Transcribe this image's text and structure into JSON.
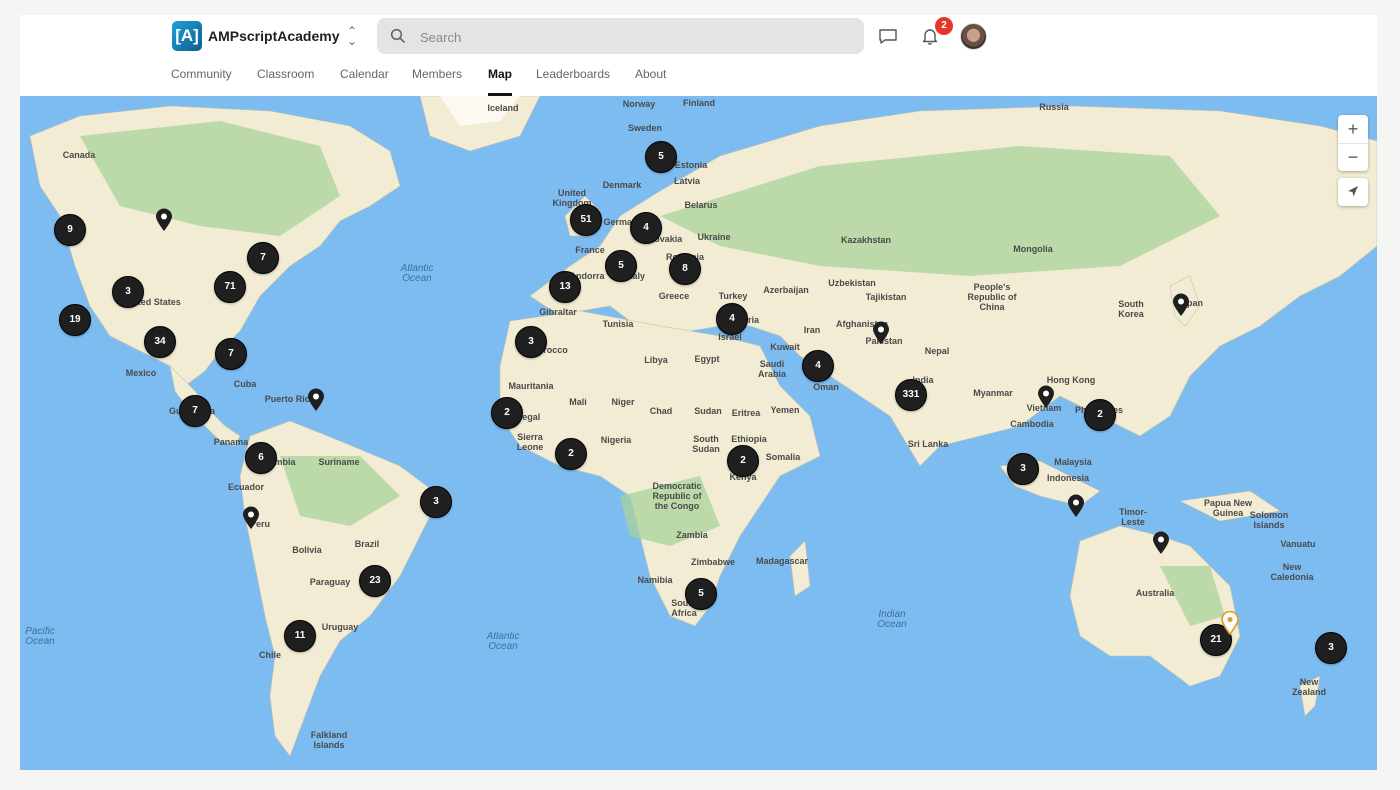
{
  "app": {
    "name": "AMPscriptAcademy",
    "logo_text": "[A]"
  },
  "search": {
    "placeholder": "Search"
  },
  "notifications": {
    "count": "2"
  },
  "nav": [
    {
      "label": "Community",
      "active": false
    },
    {
      "label": "Classroom",
      "active": false
    },
    {
      "label": "Calendar",
      "active": false
    },
    {
      "label": "Members",
      "active": false
    },
    {
      "label": "Map",
      "active": true
    },
    {
      "label": "Leaderboards",
      "active": false
    },
    {
      "label": "About",
      "active": false
    }
  ],
  "map": {
    "colors": {
      "water": "#7dbcf1",
      "land": "#f2ecd4",
      "forest": "#a9d39c",
      "cluster": "#1f1f1f",
      "highlight_pin": "#f2b54a"
    },
    "clusters": [
      "9",
      "7",
      "3",
      "71",
      "19",
      "34",
      "7",
      "7",
      "6",
      "3",
      "23",
      "11",
      "5",
      "51",
      "4",
      "5",
      "8",
      "13",
      "3",
      "2",
      "2",
      "4",
      "4",
      "2",
      "5",
      "331",
      "2",
      "3",
      "21",
      "3"
    ],
    "labels": {
      "countries": [
        "Canada",
        "United States",
        "Mexico",
        "Cuba",
        "Puerto Rico",
        "Guatemala",
        "Panama",
        "Colombia",
        "Suriname",
        "Ecuador",
        "Peru",
        "Brazil",
        "Bolivia",
        "Paraguay",
        "Uruguay",
        "Chile",
        "Falkland Islands",
        "Iceland",
        "Norway",
        "Sweden",
        "Finland",
        "Russia",
        "Estonia",
        "Latvia",
        "United Kingdom",
        "Denmark",
        "Belarus",
        "Germany",
        "France",
        "Slovakia",
        "Ukraine",
        "Romania",
        "Andorra",
        "Italy",
        "Greece",
        "Turkey",
        "Gibraltar",
        "Tunisia",
        "Morocco",
        "Libya",
        "Egypt",
        "Israel",
        "Syria",
        "Azerbaijan",
        "Uzbekistan",
        "Tajikistan",
        "Kazakhstan",
        "Mongolia",
        "People's Republic of China",
        "Iran",
        "Afghanistan",
        "Pakistan",
        "Kuwait",
        "Saudi Arabia",
        "Oman",
        "Yemen",
        "Nepal",
        "India",
        "Sri Lanka",
        "Myanmar",
        "Vietnam",
        "Cambodia",
        "Hong Kong",
        "Philippines",
        "Malaysia",
        "Indonesia",
        "Timor-Leste",
        "South Korea",
        "Japan",
        "Mauritania",
        "Mali",
        "Niger",
        "Chad",
        "Sudan",
        "Eritrea",
        "Senegal",
        "Sierra Leone",
        "Nigeria",
        "South Sudan",
        "Ethiopia",
        "Somalia",
        "Kenya",
        "Democratic Republic of the Congo",
        "Zambia",
        "Zimbabwe",
        "Madagascar",
        "Namibia",
        "South Africa",
        "Papua New Guinea",
        "Solomon Islands",
        "Vanuatu",
        "New Caledonia",
        "Australia",
        "New Zealand"
      ],
      "oceans": [
        "Atlantic Ocean",
        "Atlantic Ocean",
        "Pacific Ocean",
        "Indian Ocean"
      ]
    },
    "controls": {
      "zoom_in": "+",
      "zoom_out": "−",
      "locate": "locate"
    }
  }
}
